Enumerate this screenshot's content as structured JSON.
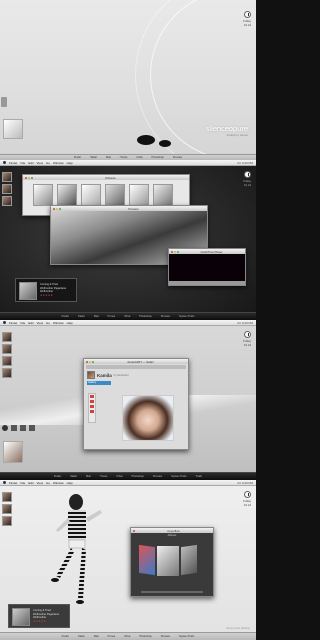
{
  "menubar": {
    "items": [
      "Finder",
      "File",
      "Edit",
      "View",
      "Go",
      "Window",
      "Help"
    ],
    "right_text": "Fri 4:20 PM"
  },
  "dock": {
    "items": [
      "Finder",
      "Safari",
      "Mail",
      "iTunes",
      "iChat",
      "Photoshop",
      "Preview",
      "System Prefs",
      "Trash"
    ]
  },
  "panel1": {
    "brand": "silenceopure",
    "brand_sub": "desktop by silence",
    "clock_time": "Friday",
    "clock_date": "10.24"
  },
  "panel2": {
    "finder_title": "Pictures",
    "preview_title": "Preview",
    "player_title": "QuickTime Player",
    "now_playing": {
      "title": "Coming & Tired",
      "artist": "Wolfmother Paganless",
      "album": "Wolfmother",
      "rating_stars": "★★★★★"
    }
  },
  "panel3": {
    "browser_title": "deviantART — Safari",
    "profile_name": "Kamila",
    "profile_sub": "by deviantart",
    "tab_label": "Gallery"
  },
  "panel4": {
    "widget_title": "Coverflow",
    "widget_sub": "Albums",
    "now_playing": {
      "title": "Coming & Tired",
      "artist": "Wolfmother Paganless",
      "album": "Wolfmother",
      "rating_stars": "★★★★★"
    },
    "footer_text": "silence pure desktop"
  }
}
